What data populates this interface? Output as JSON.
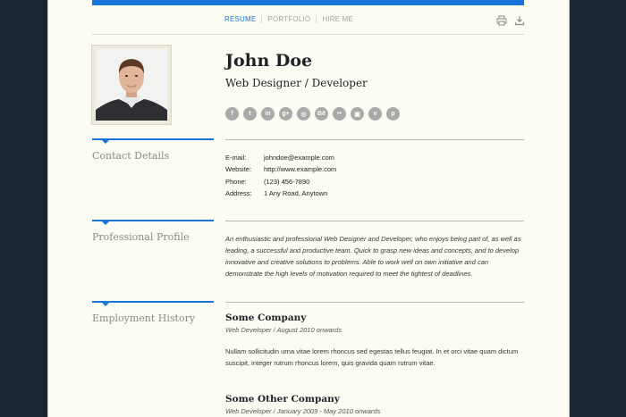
{
  "nav": {
    "items": [
      "RESUME",
      "PORTFOLIO",
      "HIRE ME"
    ],
    "active": "RESUME"
  },
  "toolbar": {
    "print_icon": "printer-icon",
    "download_icon": "download-icon"
  },
  "header": {
    "name": "John Doe",
    "title": "Web Designer / Developer"
  },
  "social_icons": [
    "facebook-icon",
    "twitter-icon",
    "linkedin-icon",
    "google-plus-icon",
    "dribbble-icon",
    "behance-icon",
    "flickr-icon",
    "instagram-icon",
    "vimeo-icon",
    "pinterest-icon"
  ],
  "sections": {
    "contact": {
      "heading": "Contact Details",
      "rows": [
        {
          "label": "E-mail:",
          "value": "johndoe@example.com"
        },
        {
          "label": "Website:",
          "value": "http://www.example.com"
        },
        {
          "label": "Phone:",
          "value": "(123) 456-7890"
        },
        {
          "label": "Address:",
          "value": "1 Any Road, Anytown"
        }
      ]
    },
    "profile": {
      "heading": "Professional Profile",
      "text": "An enthusiastic and professional Web Designer and Developer, who enjoys being part of, as well as leading, a successful and productive team. Quick to grasp new ideas and concepts, and to develop innovative and creative solutions to problems. Able to work well on own initiative and can demonstrate the high levels of motivation required to meet the tightest of deadlines."
    },
    "employment": {
      "heading": "Employment History",
      "jobs": [
        {
          "company": "Some Company",
          "meta": "Web Developer  /  August 2010 onwards",
          "desc": "Nullam sollicitudin urna vitae lorem rhoncus sed egestas tellus feugiat. In et orci vitae quam dictum suscipit, integer rutrum rhoncus lorem, quis gravida quam rutrum vitae."
        },
        {
          "company": "Some Other Company",
          "meta": "Web Developer  /  January 2009 - May 2010 onwards",
          "desc": ""
        }
      ]
    }
  },
  "colors": {
    "accent": "#1a73d8",
    "paper": "#fdfcf3",
    "backdrop": "#1b2533"
  }
}
